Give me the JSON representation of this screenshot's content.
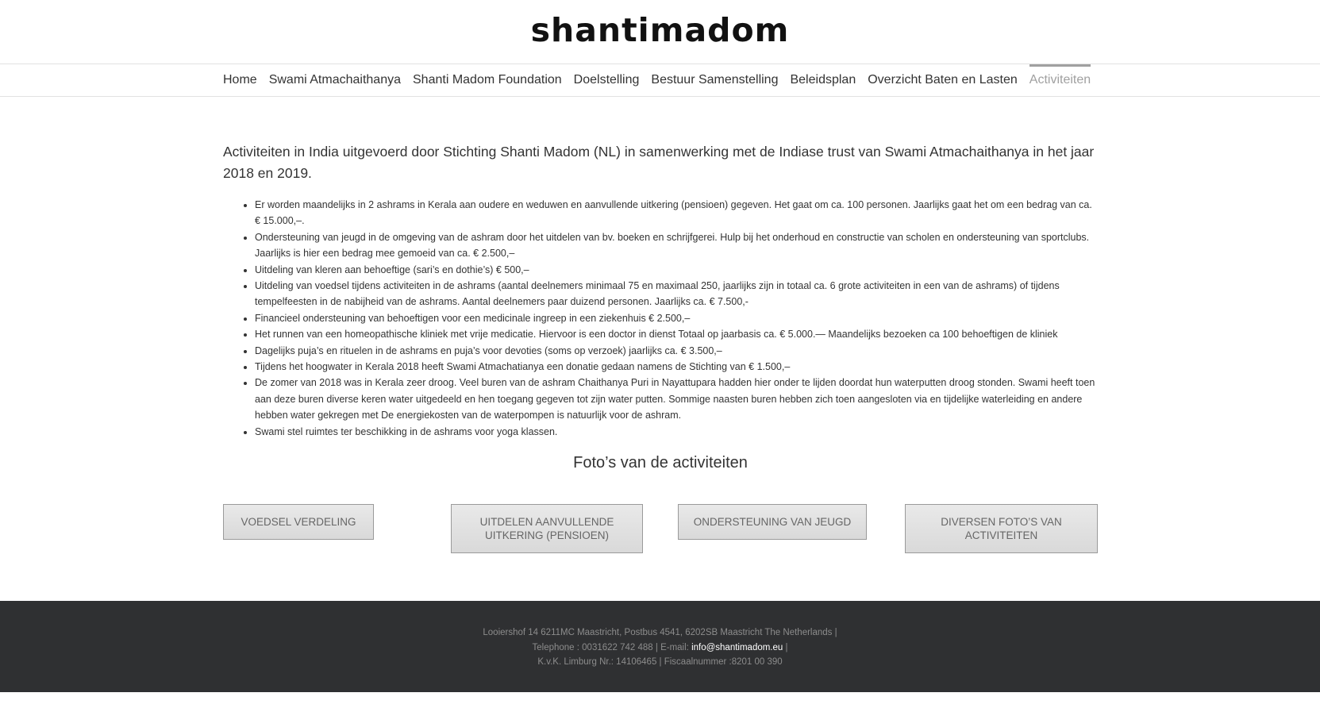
{
  "logo": "shantimadom",
  "nav": {
    "items": [
      {
        "label": "Home"
      },
      {
        "label": "Swami Atmachaithanya"
      },
      {
        "label": "Shanti Madom Foundation"
      },
      {
        "label": "Doelstelling"
      },
      {
        "label": "Bestuur Samenstelling"
      },
      {
        "label": "Beleidsplan"
      },
      {
        "label": "Overzicht Baten en Lasten"
      },
      {
        "label": "Activiteiten",
        "active": true
      }
    ]
  },
  "main": {
    "intro": "Activiteiten in India uitgevoerd door Stichting Shanti Madom (NL) in samenwerking met de Indiase trust van Swami Atmachaithanya in het jaar 2018 en 2019.",
    "bullets": [
      "Er worden maandelijks in 2 ashrams in Kerala aan oudere en weduwen en aanvullende uitkering  (pensioen) gegeven. Het gaat om ca. 100 personen.  Jaarlijks gaat het om een bedrag van ca. € 15.000,–.",
      "Ondersteuning van jeugd in de omgeving van de ashram door het uitdelen van bv. boeken en schrijfgerei. Hulp bij het onderhoud en constructie van scholen en ondersteuning van sportclubs. Jaarlijks is hier een bedrag mee gemoeid van ca. € 2.500,–",
      "Uitdeling van kleren aan behoeftige (sari’s en dothie’s) €  500,–",
      "Uitdeling van voedsel tijdens activiteiten in de ashrams (aantal deelnemers minimaal 75 en maximaal 250, jaarlijks zijn in totaal ca. 6 grote activiteiten in een van de ashrams) of tijdens tempelfeesten in de nabijheid van de ashrams. Aantal deelnemers paar duizend personen.  Jaarlijks ca. € 7.500,-",
      "Financieel ondersteuning van behoeftigen voor een medicinale ingreep in een ziekenhuis € 2.500,–",
      "Het runnen van een homeopathische kliniek met vrije medicatie. Hiervoor is een doctor in dienst Totaal op jaarbasis ca. € 5.000.— Maandelijks bezoeken  ca 100 behoeftigen de kliniek",
      "Dagelijks puja’s en rituelen in de ashrams en puja’s voor devoties (soms op verzoek) jaarlijks ca. € 3.500,–",
      "Tijdens het hoogwater in Kerala 2018 heeft Swami Atmachatianya een donatie gedaan namens de Stichting van € 1.500,–",
      "De zomer van 2018 was in Kerala zeer droog. Veel buren van de ashram Chaithanya Puri in Nayattupara hadden hier onder te lijden doordat hun waterputten droog stonden. Swami heeft toen aan deze buren diverse keren water uitgedeeld en hen toegang gegeven tot zijn water putten. Sommige naasten buren hebben zich toen aangesloten via en tijdelijke waterleiding en andere hebben water gekregen met  De energiekosten van de waterpompen is natuurlijk voor de ashram.",
      "Swami stel ruimtes ter beschikking in de ashrams voor yoga klassen."
    ],
    "photos_heading": "Foto’s van de activiteiten",
    "buttons": [
      {
        "label": "VOEDSEL VERDELING"
      },
      {
        "label": "UITDELEN AANVULLENDE UITKERING (PENSIOEN)"
      },
      {
        "label": "ONDERSTEUNING VAN JEUGD"
      },
      {
        "label": "DIVERSEN FOTO’S VAN ACTIVITEITEN"
      }
    ]
  },
  "footer": {
    "line1": "Looiershof 14 6211MC Maastricht, Postbus 4541, 6202SB Maastricht The Netherlands |",
    "line2_prefix": "Telephone : 0031622 742 488 | E-mail: ",
    "email": "info@shantimadom.eu",
    "line2_suffix": " |",
    "line3": "K.v.K. Limburg Nr.: 14106465 | Fiscaalnummer :8201 00 390"
  },
  "colors": {
    "footer_bg": "#2f3032",
    "nav_active": "#a0a0a0",
    "button_bg": "#e2e2e2"
  }
}
